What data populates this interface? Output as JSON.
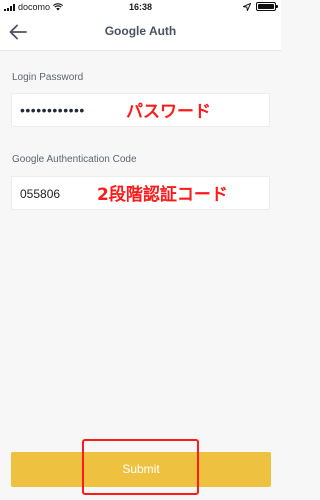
{
  "status_bar": {
    "carrier": "docomo",
    "time": "16:38",
    "battery_level": 1.0
  },
  "nav": {
    "title": "Google Auth",
    "back_icon": "arrow-left-icon"
  },
  "form": {
    "password_label": "Login Password",
    "password_value": "••••••••••••",
    "password_annotation": "パスワード",
    "code_label": "Google Authentication Code",
    "code_value": "055806",
    "code_annotation": "2段階認証コード"
  },
  "submit": {
    "label": "Submit"
  },
  "colors": {
    "accent": "#eec240",
    "annotation": "#ff1a1a",
    "background": "#f7f7f7",
    "title": "#4a5262"
  }
}
